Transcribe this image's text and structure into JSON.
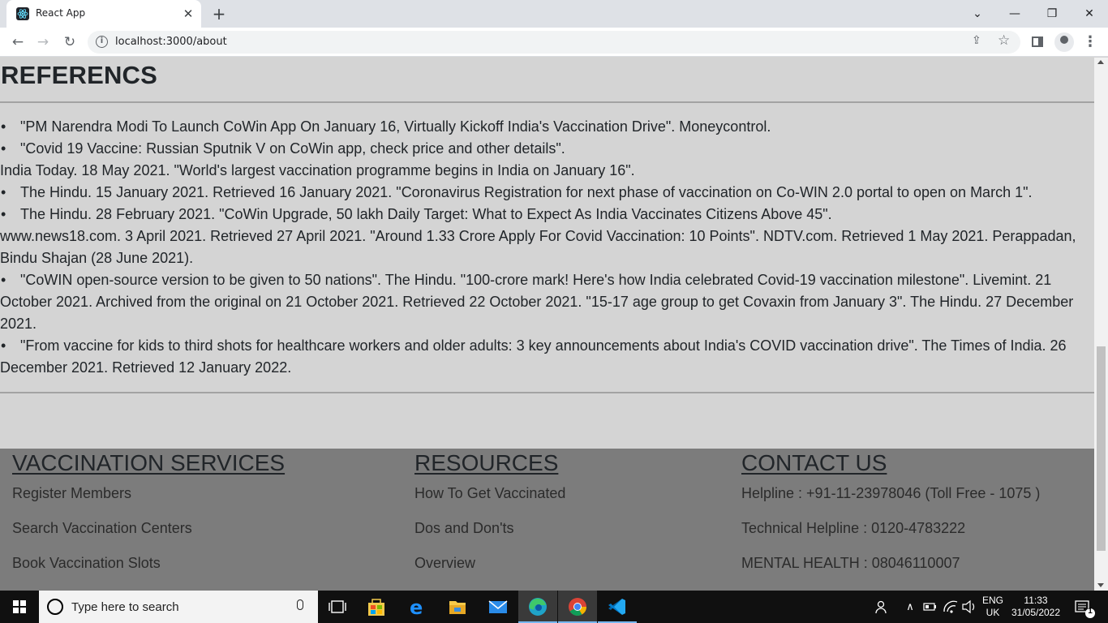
{
  "browser": {
    "tab_title": "React App",
    "url": "localhost:3000/about",
    "tab_close": "✕",
    "new_tab": "+"
  },
  "page": {
    "references_title": "REFERENCS",
    "bullet": "•",
    "references": [
      {
        "bullet": true,
        "text": "\"PM Narendra Modi To Launch CoWin App On January 16, Virtually Kickoff India's Vaccination Drive\". Moneycontrol."
      },
      {
        "bullet": true,
        "text": "\"Covid 19 Vaccine: Russian Sputnik V on CoWin app, check price and other details\"."
      },
      {
        "bullet": false,
        "text": "India Today. 18 May 2021. \"World's largest vaccination programme begins in India on January 16\"."
      },
      {
        "bullet": true,
        "text": "The Hindu. 15 January 2021. Retrieved 16 January 2021. \"Coronavirus Registration for next phase of vaccination on Co-WIN 2.0 portal to open on March 1\"."
      },
      {
        "bullet": true,
        "text": "The Hindu. 28 February 2021. \"CoWin Upgrade, 50 lakh Daily Target: What to Expect As India Vaccinates Citizens Above 45\"."
      },
      {
        "bullet": false,
        "text": "www.news18.com. 3 April 2021. Retrieved 27 April 2021. \"Around 1.33 Crore Apply For Covid Vaccination: 10 Points\". NDTV.com. Retrieved 1 May 2021. Perappadan, Bindu Shajan (28 June 2021)."
      },
      {
        "bullet": true,
        "text": "\"CoWIN open-source version to be given to 50 nations\". The Hindu. \"100-crore mark! Here's how India celebrated Covid-19 vaccination milestone\". Livemint. 21 October 2021. Archived from the original on 21 October 2021. Retrieved 22 October 2021. \"15-17 age group to get Covaxin from January 3\". The Hindu. 27 December 2021."
      },
      {
        "bullet": true,
        "text": "\"From vaccine for kids to third shots for healthcare workers and older adults: 3 key announcements about India's COVID vaccination drive\". The Times of India. 26 December 2021. Retrieved 12 January 2022."
      }
    ]
  },
  "footer": {
    "services": {
      "heading": "VACCINATION SERVICES",
      "links": [
        "Register Members",
        "Search Vaccination Centers",
        "Book Vaccination Slots"
      ]
    },
    "resources": {
      "heading": "RESOURCES",
      "links": [
        "How To Get Vaccinated",
        "Dos and Don'ts",
        "Overview"
      ]
    },
    "contact": {
      "heading": "CONTACT US",
      "lines": [
        "Helpline : +91-11-23978046 (Toll Free - 1075 )",
        "Technical Helpline : 0120-4783222",
        "MENTAL HEALTH : 08046110007"
      ]
    }
  },
  "taskbar": {
    "search_placeholder": "Type here to search",
    "lang_top": "ENG",
    "lang_bottom": "UK",
    "time": "11:33",
    "date": "31/05/2022",
    "notification_count": "1",
    "apps": [
      "task-view",
      "microsoft-store",
      "edge-legacy",
      "file-explorer",
      "mail",
      "edge",
      "chrome",
      "vscode"
    ]
  },
  "colors": {
    "page_bg": "#d4d4d4",
    "footer_bg": "#7c7c7c",
    "taskbar_bg": "#101010"
  }
}
